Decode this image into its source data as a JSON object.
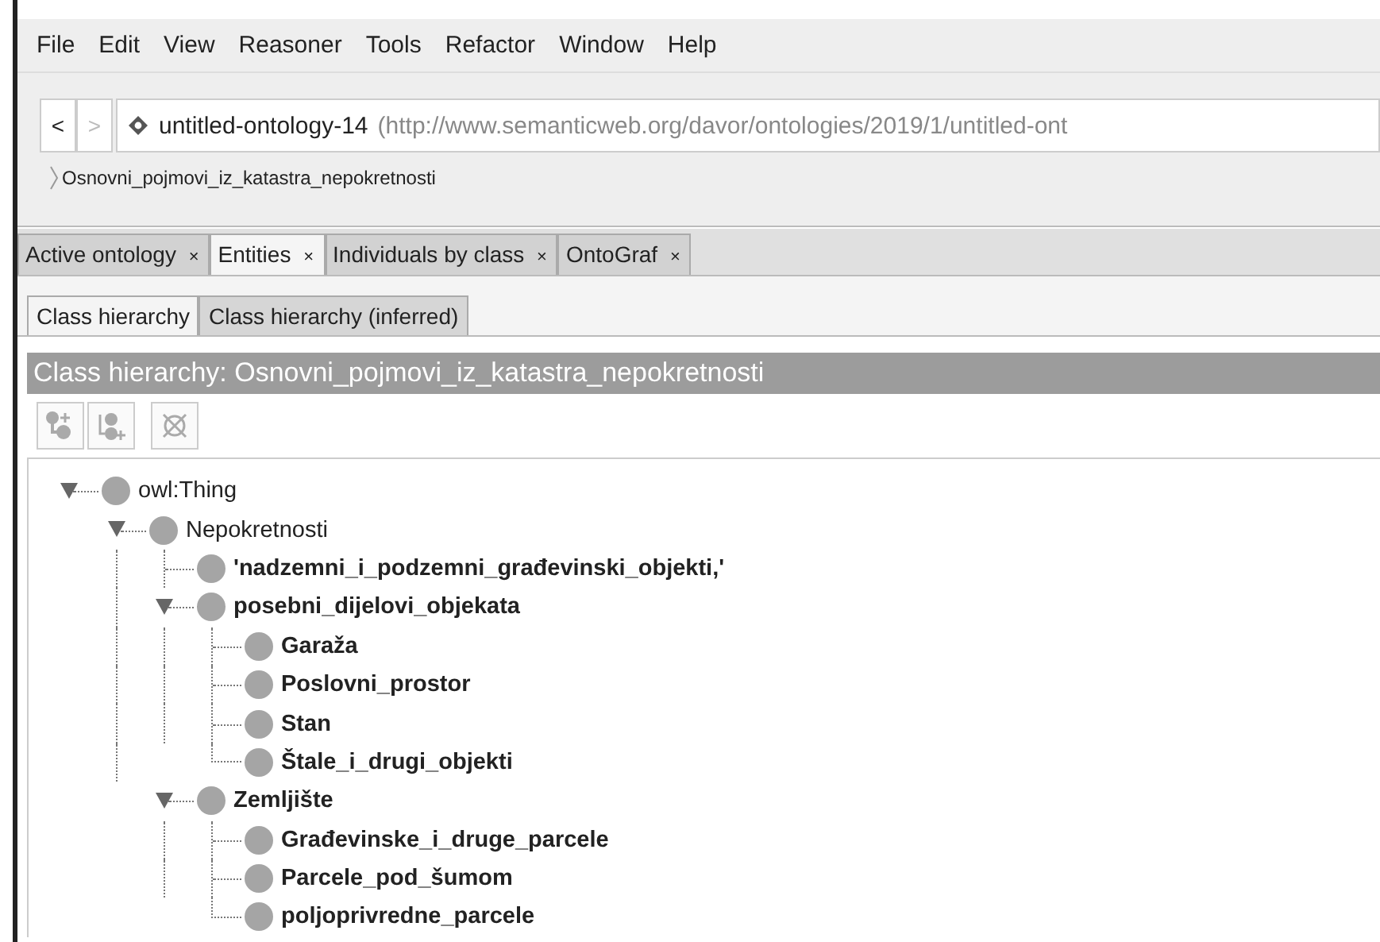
{
  "menu": [
    "File",
    "Edit",
    "View",
    "Reasoner",
    "Tools",
    "Refactor",
    "Window",
    "Help"
  ],
  "nav": {
    "buttons": [
      {
        "label": "<",
        "disabled": false
      },
      {
        "label": ">",
        "disabled": true
      }
    ],
    "ontology_name": "untitled-ontology-14",
    "ontology_iri": "(http://www.semanticweb.org/davor/ontologies/2019/1/untitled-ont",
    "breadcrumb": "Osnovni_pojmovi_iz_katastra_nepokretnosti"
  },
  "tabs": [
    {
      "label": "Active ontology",
      "close": "×",
      "selected": false
    },
    {
      "label": "Entities",
      "close": "×",
      "selected": true
    },
    {
      "label": "Individuals by class",
      "close": "×",
      "selected": false
    },
    {
      "label": "OntoGraf",
      "close": "×",
      "selected": false
    }
  ],
  "subtabs": [
    {
      "label": "Class hierarchy",
      "selected": true
    },
    {
      "label": "Class hierarchy (inferred)",
      "selected": false
    }
  ],
  "panel_title": "Class hierarchy: Osnovni_pojmovi_iz_katastra_nepokretnosti",
  "toolbar": [
    {
      "kind": "add-subclass",
      "disabled": true
    },
    {
      "kind": "add-sibling",
      "disabled": true
    },
    {
      "kind": "delete",
      "disabled": true
    }
  ],
  "tree": [
    {
      "label": "owl:Thing",
      "bold": false,
      "expanded": true,
      "children": [
        {
          "label": "Nepokretnosti",
          "bold": false,
          "expanded": true,
          "children": [
            {
              "label": "'nadzemni_i_podzemni_građevinski_objekti,'",
              "bold": true
            },
            {
              "label": "posebni_dijelovi_objekata",
              "bold": true,
              "expanded": true,
              "children": [
                {
                  "label": "Garaža",
                  "bold": true
                },
                {
                  "label": "Poslovni_prostor",
                  "bold": true
                },
                {
                  "label": "Stan",
                  "bold": true
                },
                {
                  "label": "Štale_i_drugi_objekti",
                  "bold": true
                }
              ]
            },
            {
              "label": "Zemljište",
              "bold": true,
              "expanded": true,
              "children": [
                {
                  "label": "Građevinske_i_druge_parcele",
                  "bold": true
                },
                {
                  "label": "Parcele_pod_šumom",
                  "bold": true
                },
                {
                  "label": "poljoprivredne_parcele",
                  "bold": true
                }
              ]
            }
          ]
        }
      ]
    }
  ]
}
